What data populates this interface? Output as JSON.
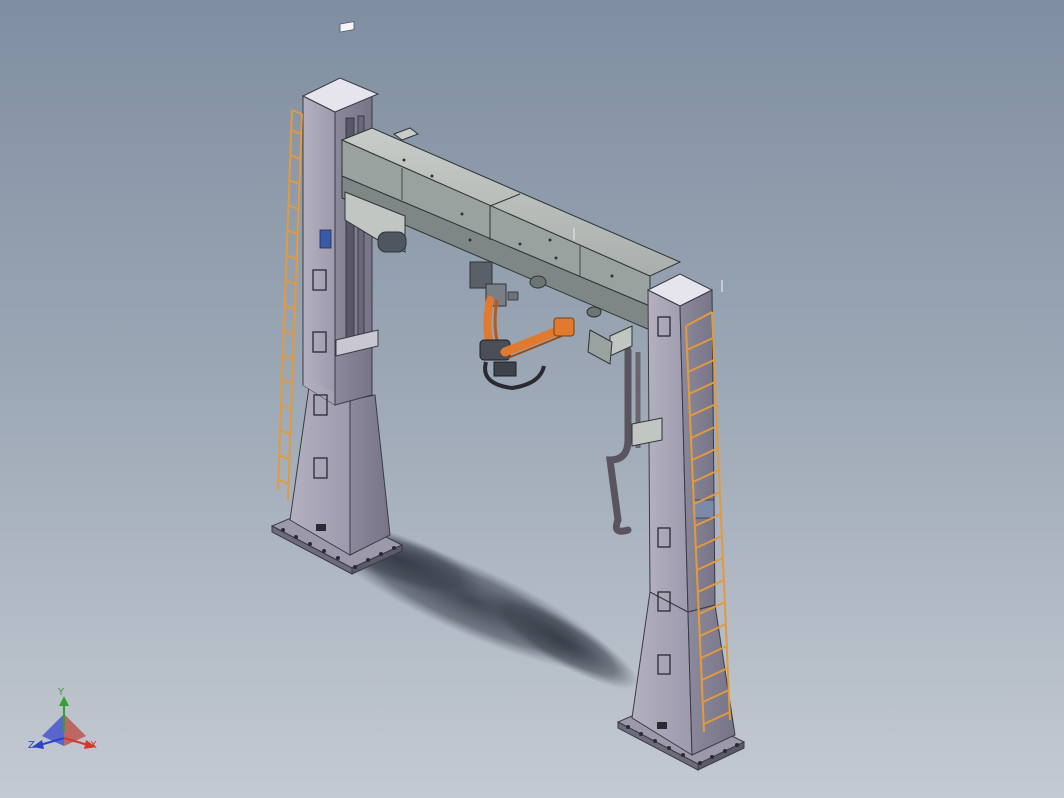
{
  "viewport": {
    "background_top": "#7f8ea1",
    "background_bottom": "#c4cad3"
  },
  "model": {
    "colors": {
      "column_front": "#a8a5b4",
      "column_side": "#8f8c9e",
      "column_top": "#e6e4ec",
      "beam_top": "#b9bdbc",
      "beam_side": "#8f9796",
      "ladder": "#e39a3c",
      "robot_orange": "#e07a2e",
      "cable": "#6a6470",
      "panel_blue": "#3a5aa8",
      "shadow": "#4c5360"
    }
  },
  "triad": {
    "y_label": "Y",
    "z_label": "Z",
    "x_label": "X",
    "y_color": "#2fa42f",
    "z_color": "#2d42c8",
    "x_color": "#d43a2a"
  }
}
